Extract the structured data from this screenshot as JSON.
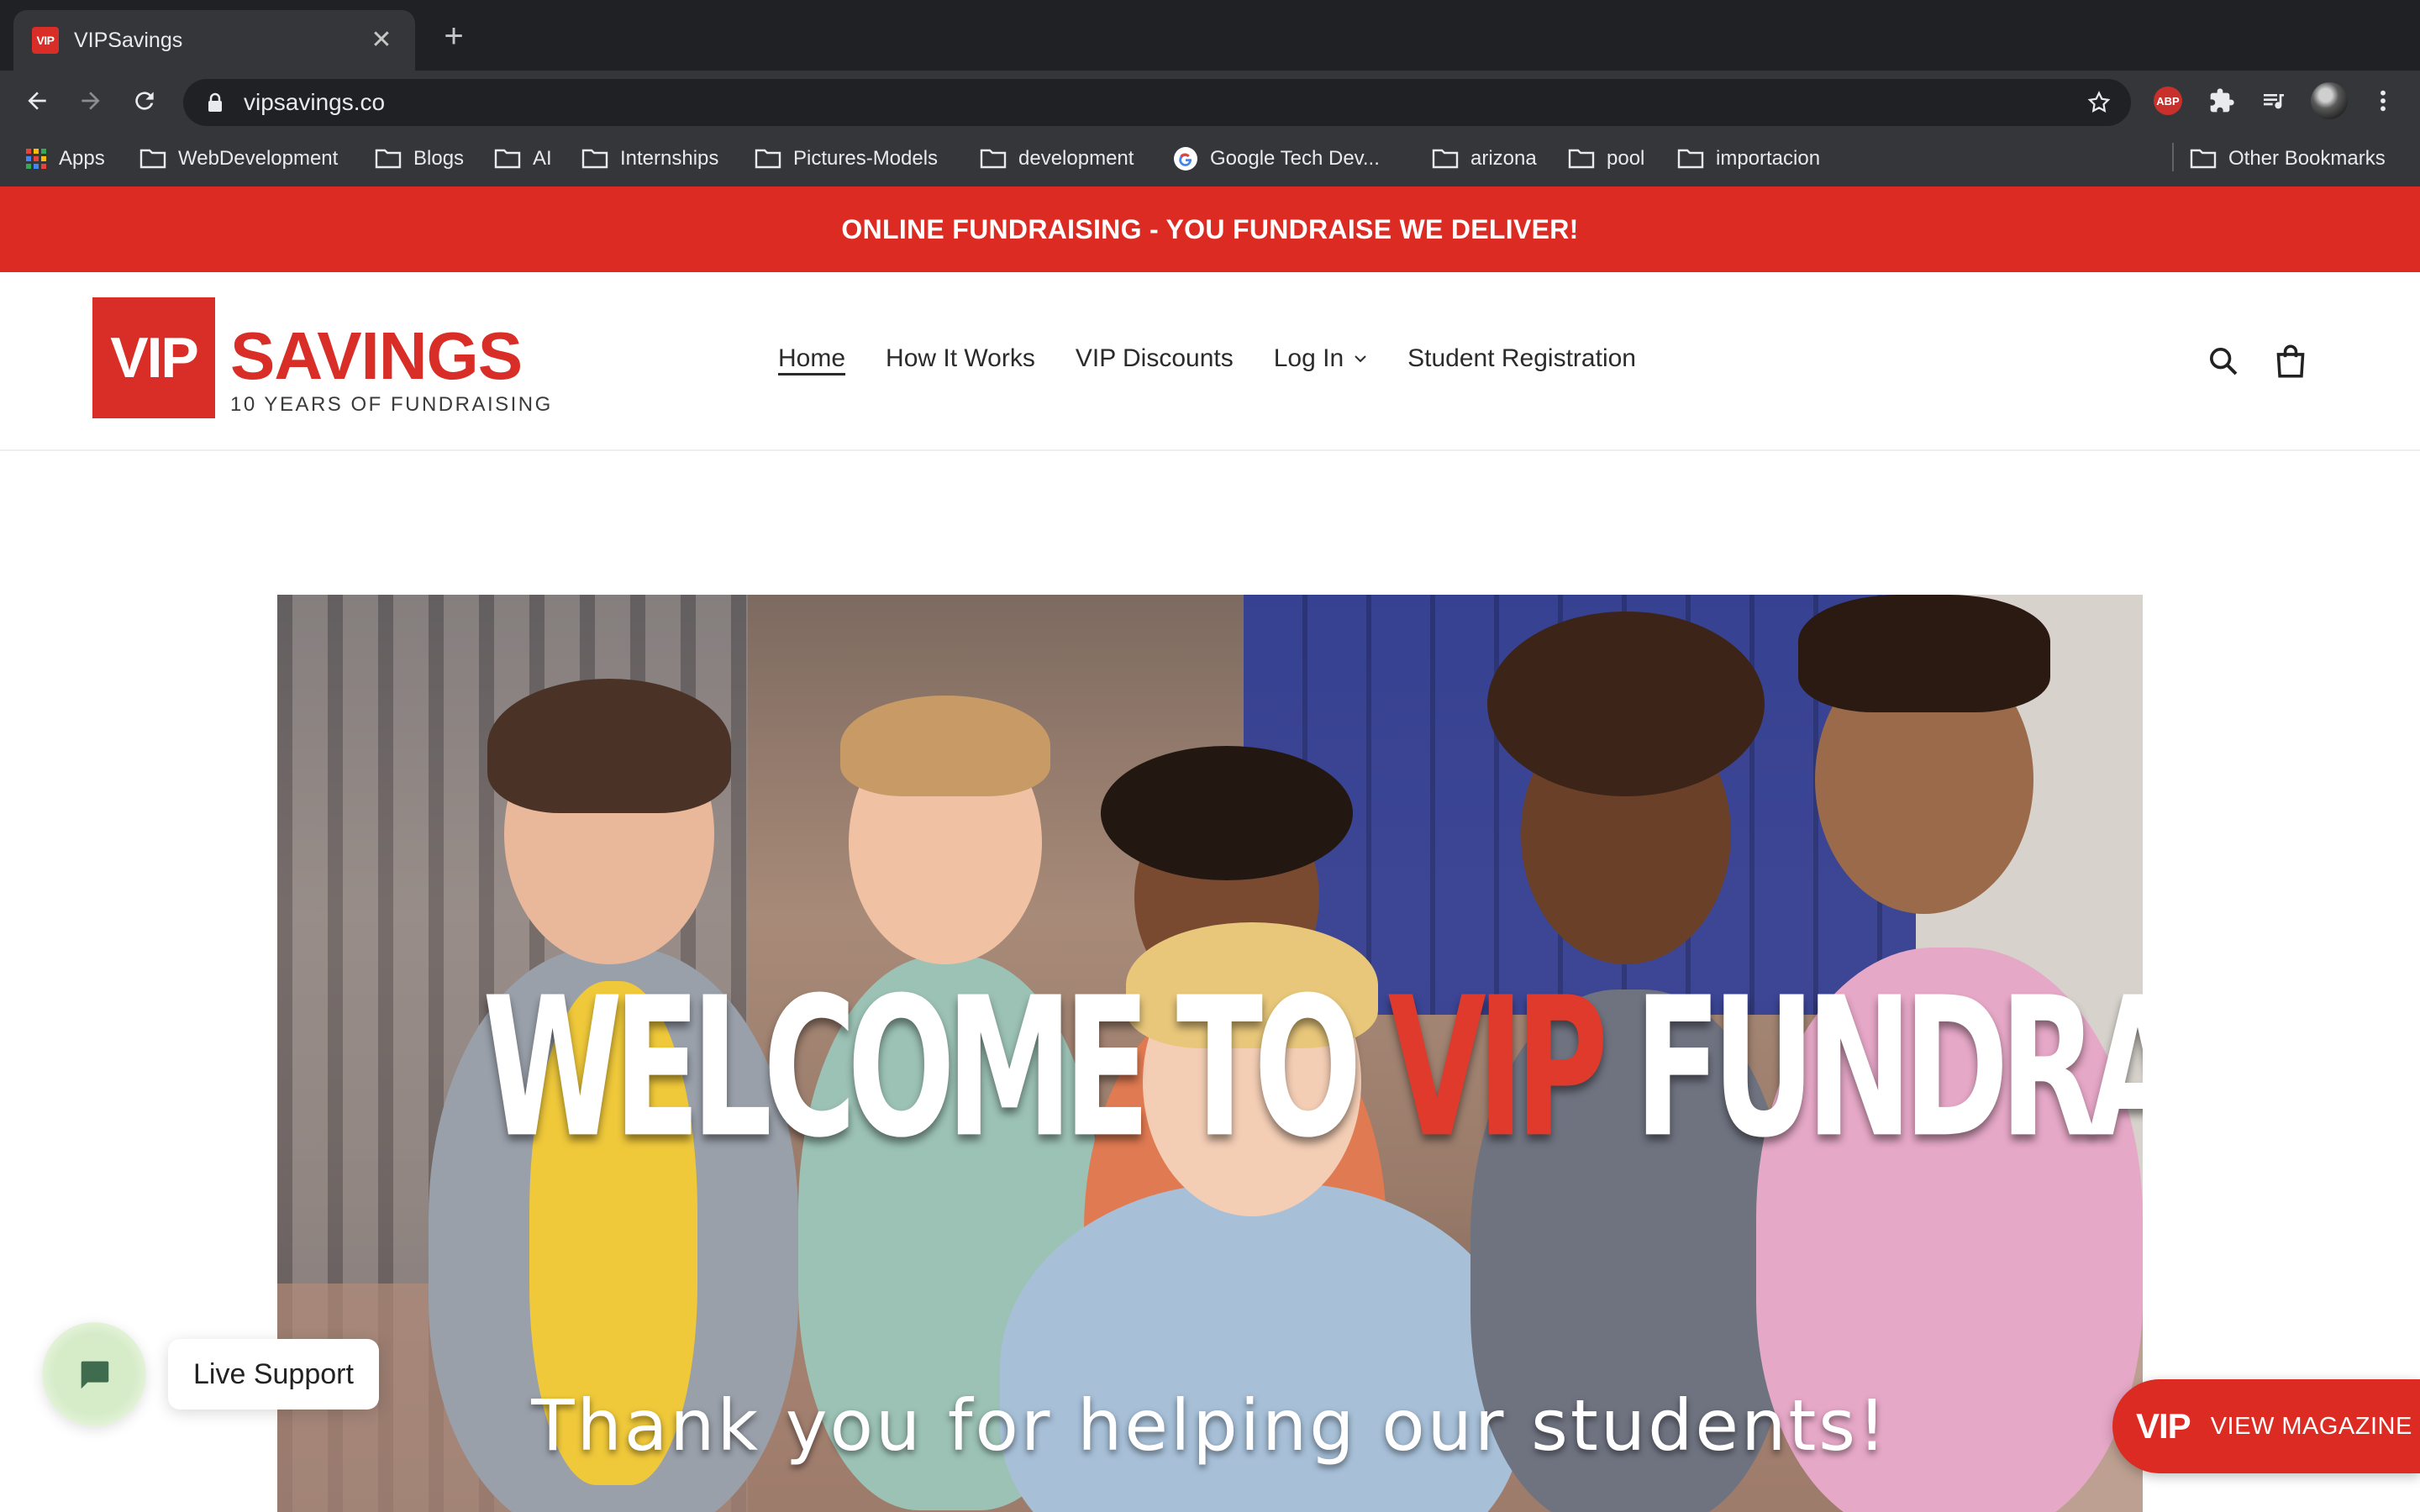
{
  "browser": {
    "tab": {
      "favicon_text": "VIP",
      "title": "VIPSavings",
      "close_glyph": "✕"
    },
    "new_tab_glyph": "+",
    "url": "vipsavings.co",
    "extensions": {
      "abp_label": "ABP"
    },
    "bookmarks": [
      {
        "label": "Apps",
        "icon": "apps-grid-icon"
      },
      {
        "label": "WebDevelopment",
        "icon": "folder-icon"
      },
      {
        "label": "Blogs",
        "icon": "folder-icon"
      },
      {
        "label": "AI",
        "icon": "folder-icon"
      },
      {
        "label": "Internships",
        "icon": "folder-icon"
      },
      {
        "label": "Pictures-Models",
        "icon": "folder-icon"
      },
      {
        "label": "development",
        "icon": "folder-icon"
      },
      {
        "label": "Google Tech Dev...",
        "icon": "google-icon"
      },
      {
        "label": "arizona",
        "icon": "folder-icon"
      },
      {
        "label": "pool",
        "icon": "folder-icon"
      },
      {
        "label": "importacion",
        "icon": "folder-icon"
      },
      {
        "label": "Other Bookmarks",
        "icon": "folder-icon"
      }
    ]
  },
  "site": {
    "announcement": "ONLINE FUNDRAISING - YOU FUNDRAISE WE DELIVER!",
    "logo": {
      "box_text": "VIP",
      "word": "SAVINGS",
      "tagline": "10 YEARS OF FUNDRAISING"
    },
    "nav": [
      {
        "label": "Home",
        "active": true
      },
      {
        "label": "How It Works"
      },
      {
        "label": "VIP Discounts"
      },
      {
        "label": "Log In",
        "has_dropdown": true
      },
      {
        "label": "Student Registration"
      }
    ],
    "hero": {
      "title_part1": "WELCOME TO ",
      "title_accent": "VIP",
      "title_part2": " FUNDRAISING",
      "subtitle": "Thank you for helping our students!"
    },
    "chat": {
      "label": "Live Support"
    },
    "magazine": {
      "vip": "VIP",
      "label": "VIEW MAGAZINE"
    }
  },
  "colors": {
    "brand_red": "#dc2b23",
    "chrome_dark": "#202124",
    "chrome_toolbar": "#35363a"
  }
}
